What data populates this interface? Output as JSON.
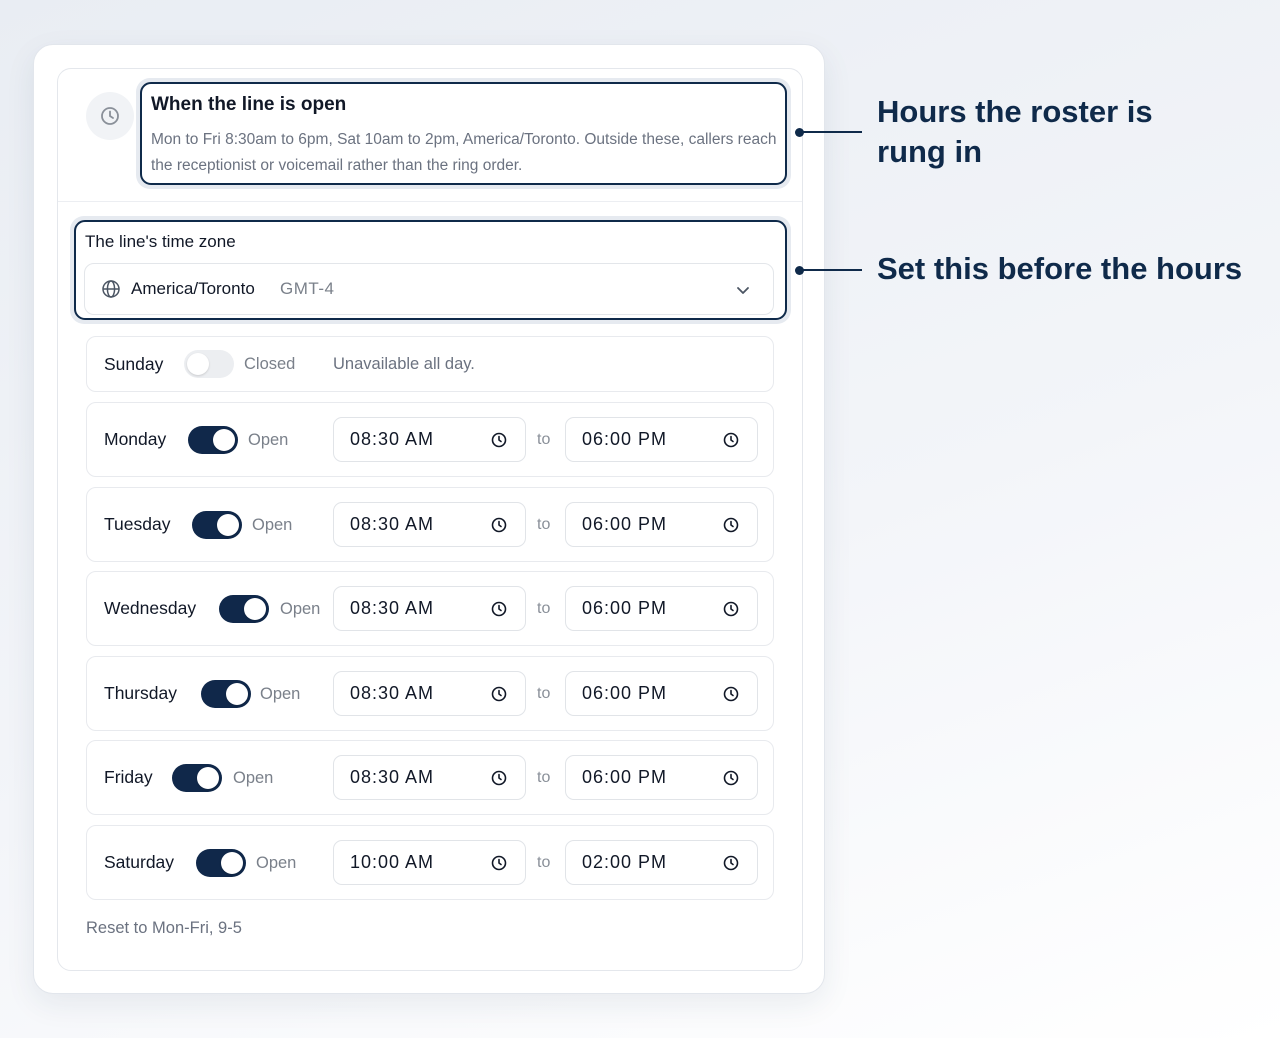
{
  "header": {
    "icon": "clock-icon",
    "title": "When the line is open",
    "description": "Mon to Fri 8:30am to 6pm, Sat 10am to 2pm, America/Toronto. Outside these, callers reach the receptionist or voicemail rather than the ring order."
  },
  "timezone": {
    "label": "The line's time zone",
    "icon": "globe-icon",
    "value": "America/Toronto",
    "offset": "GMT-4"
  },
  "days": [
    {
      "name": "Sunday",
      "enabled": false,
      "state": "Closed",
      "note": "Unavailable all day."
    },
    {
      "name": "Monday",
      "enabled": true,
      "state": "Open",
      "from": "08:30 AM",
      "to_word": "to",
      "until": "06:00 PM"
    },
    {
      "name": "Tuesday",
      "enabled": true,
      "state": "Open",
      "from": "08:30 AM",
      "to_word": "to",
      "until": "06:00 PM"
    },
    {
      "name": "Wednesday",
      "enabled": true,
      "state": "Open",
      "from": "08:30 AM",
      "to_word": "to",
      "until": "06:00 PM"
    },
    {
      "name": "Thursday",
      "enabled": true,
      "state": "Open",
      "from": "08:30 AM",
      "to_word": "to",
      "until": "06:00 PM"
    },
    {
      "name": "Friday",
      "enabled": true,
      "state": "Open",
      "from": "08:30 AM",
      "to_word": "to",
      "until": "06:00 PM"
    },
    {
      "name": "Saturday",
      "enabled": true,
      "state": "Open",
      "from": "10:00 AM",
      "to_word": "to",
      "until": "02:00 PM"
    }
  ],
  "reset_label": "Reset to Mon-Fri, 9-5",
  "callouts": [
    {
      "text_line1": "Hours the roster is",
      "text_line2": "rung in"
    },
    {
      "text_line1": "Set this before the hours"
    }
  ],
  "colors": {
    "accent": "#0f2a4a",
    "toggle_on": "#10284a",
    "muted_text": "#6b7280"
  }
}
